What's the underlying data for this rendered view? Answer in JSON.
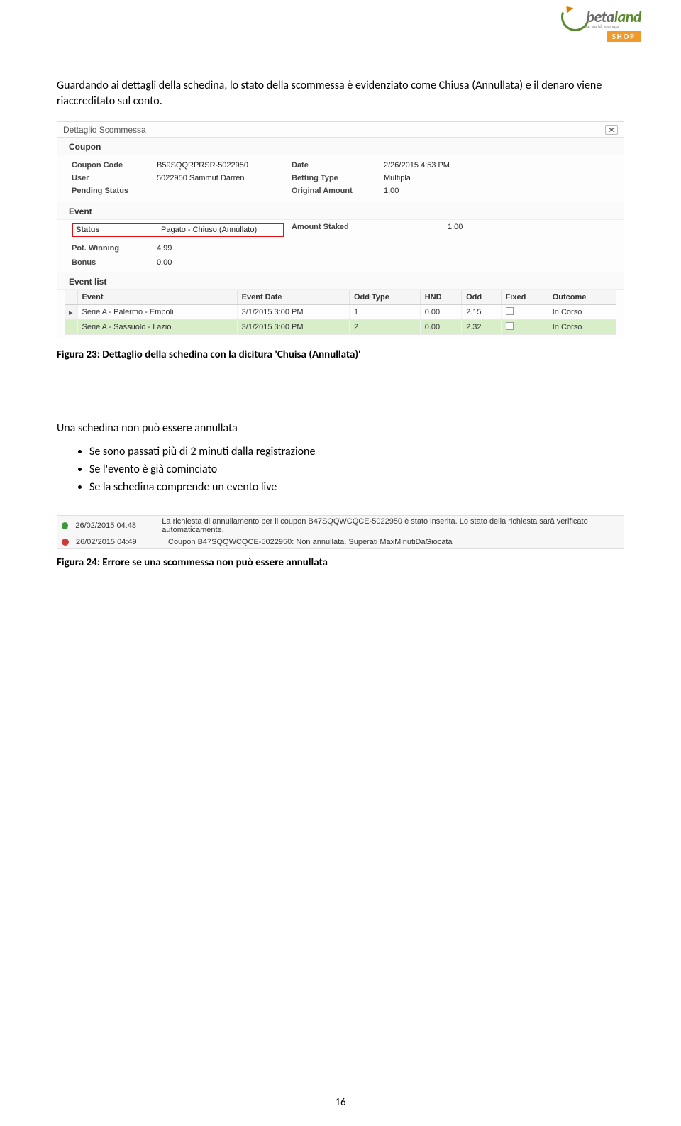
{
  "logo": {
    "beta": "beta",
    "land": "land",
    "tag": "your world, your goal",
    "shop": "SHOP"
  },
  "para1": "Guardando ai dettagli della schedina, lo stato della scommessa è evidenziato come Chiusa (Annullata) e il denaro viene riaccreditato sul conto.",
  "detail": {
    "window_title": "Dettaglio Scommessa",
    "close": "×",
    "sect_coupon": "Coupon",
    "labels": {
      "coupon_code": "Coupon Code",
      "date": "Date",
      "user": "User",
      "betting_type": "Betting Type",
      "pending_status": "Pending Status",
      "original_amount": "Original Amount"
    },
    "values": {
      "coupon_code": "B59SQQRPRSR-5022950",
      "date": "2/26/2015 4:53 PM",
      "user": "5022950 Sammut Darren",
      "betting_type": "Multipla",
      "pending_status": "",
      "original_amount": "1.00"
    },
    "sect_event": "Event",
    "event_labels": {
      "status": "Status",
      "amount_staked": "Amount Staked",
      "pot_winning": "Pot. Winning",
      "bonus": "Bonus"
    },
    "event_values": {
      "status": "Pagato - Chiuso (Annullato)",
      "amount_staked": "1.00",
      "pot_winning": "4.99",
      "bonus": "0.00"
    },
    "sect_event_list": "Event list",
    "table": {
      "headers": [
        "",
        "Event",
        "Event Date",
        "Odd Type",
        "HND",
        "Odd",
        "Fixed",
        "Outcome"
      ],
      "rows": [
        {
          "marker": "▸",
          "cells": [
            "Serie A - Palermo - Empoli",
            "3/1/2015 3:00 PM",
            "1",
            "0.00",
            "2.15",
            "",
            "In Corso"
          ],
          "green": false
        },
        {
          "marker": "",
          "cells": [
            "Serie A - Sassuolo - Lazio",
            "3/1/2015 3:00 PM",
            "2",
            "0.00",
            "2.32",
            "",
            "In Corso"
          ],
          "green": true
        }
      ]
    }
  },
  "caption1": "Figura 23: Dettaglio della schedina con la dicitura 'Chuisa (Annullata)'",
  "para2": "Una schedina non può essere annullata",
  "bullets": [
    "Se sono passati più di 2 minuti dalla registrazione",
    "Se l'evento è già cominciato",
    "Se la schedina comprende un evento live"
  ],
  "log": {
    "rows": [
      {
        "color": "green",
        "ts": "26/02/2015 04:48",
        "msg": "La richiesta di annullamento per il coupon B47SQQWCQCE-5022950 è stato inserita. Lo stato della richiesta sarà verificato automaticamente."
      },
      {
        "color": "red",
        "ts": "26/02/2015 04:49",
        "msg": "Coupon B47SQQWCQCE-5022950: Non annullata. Superati MaxMinutiDaGiocata"
      }
    ]
  },
  "caption2": "Figura 24: Errore se una scommessa non può essere annullata",
  "page_number": "16"
}
